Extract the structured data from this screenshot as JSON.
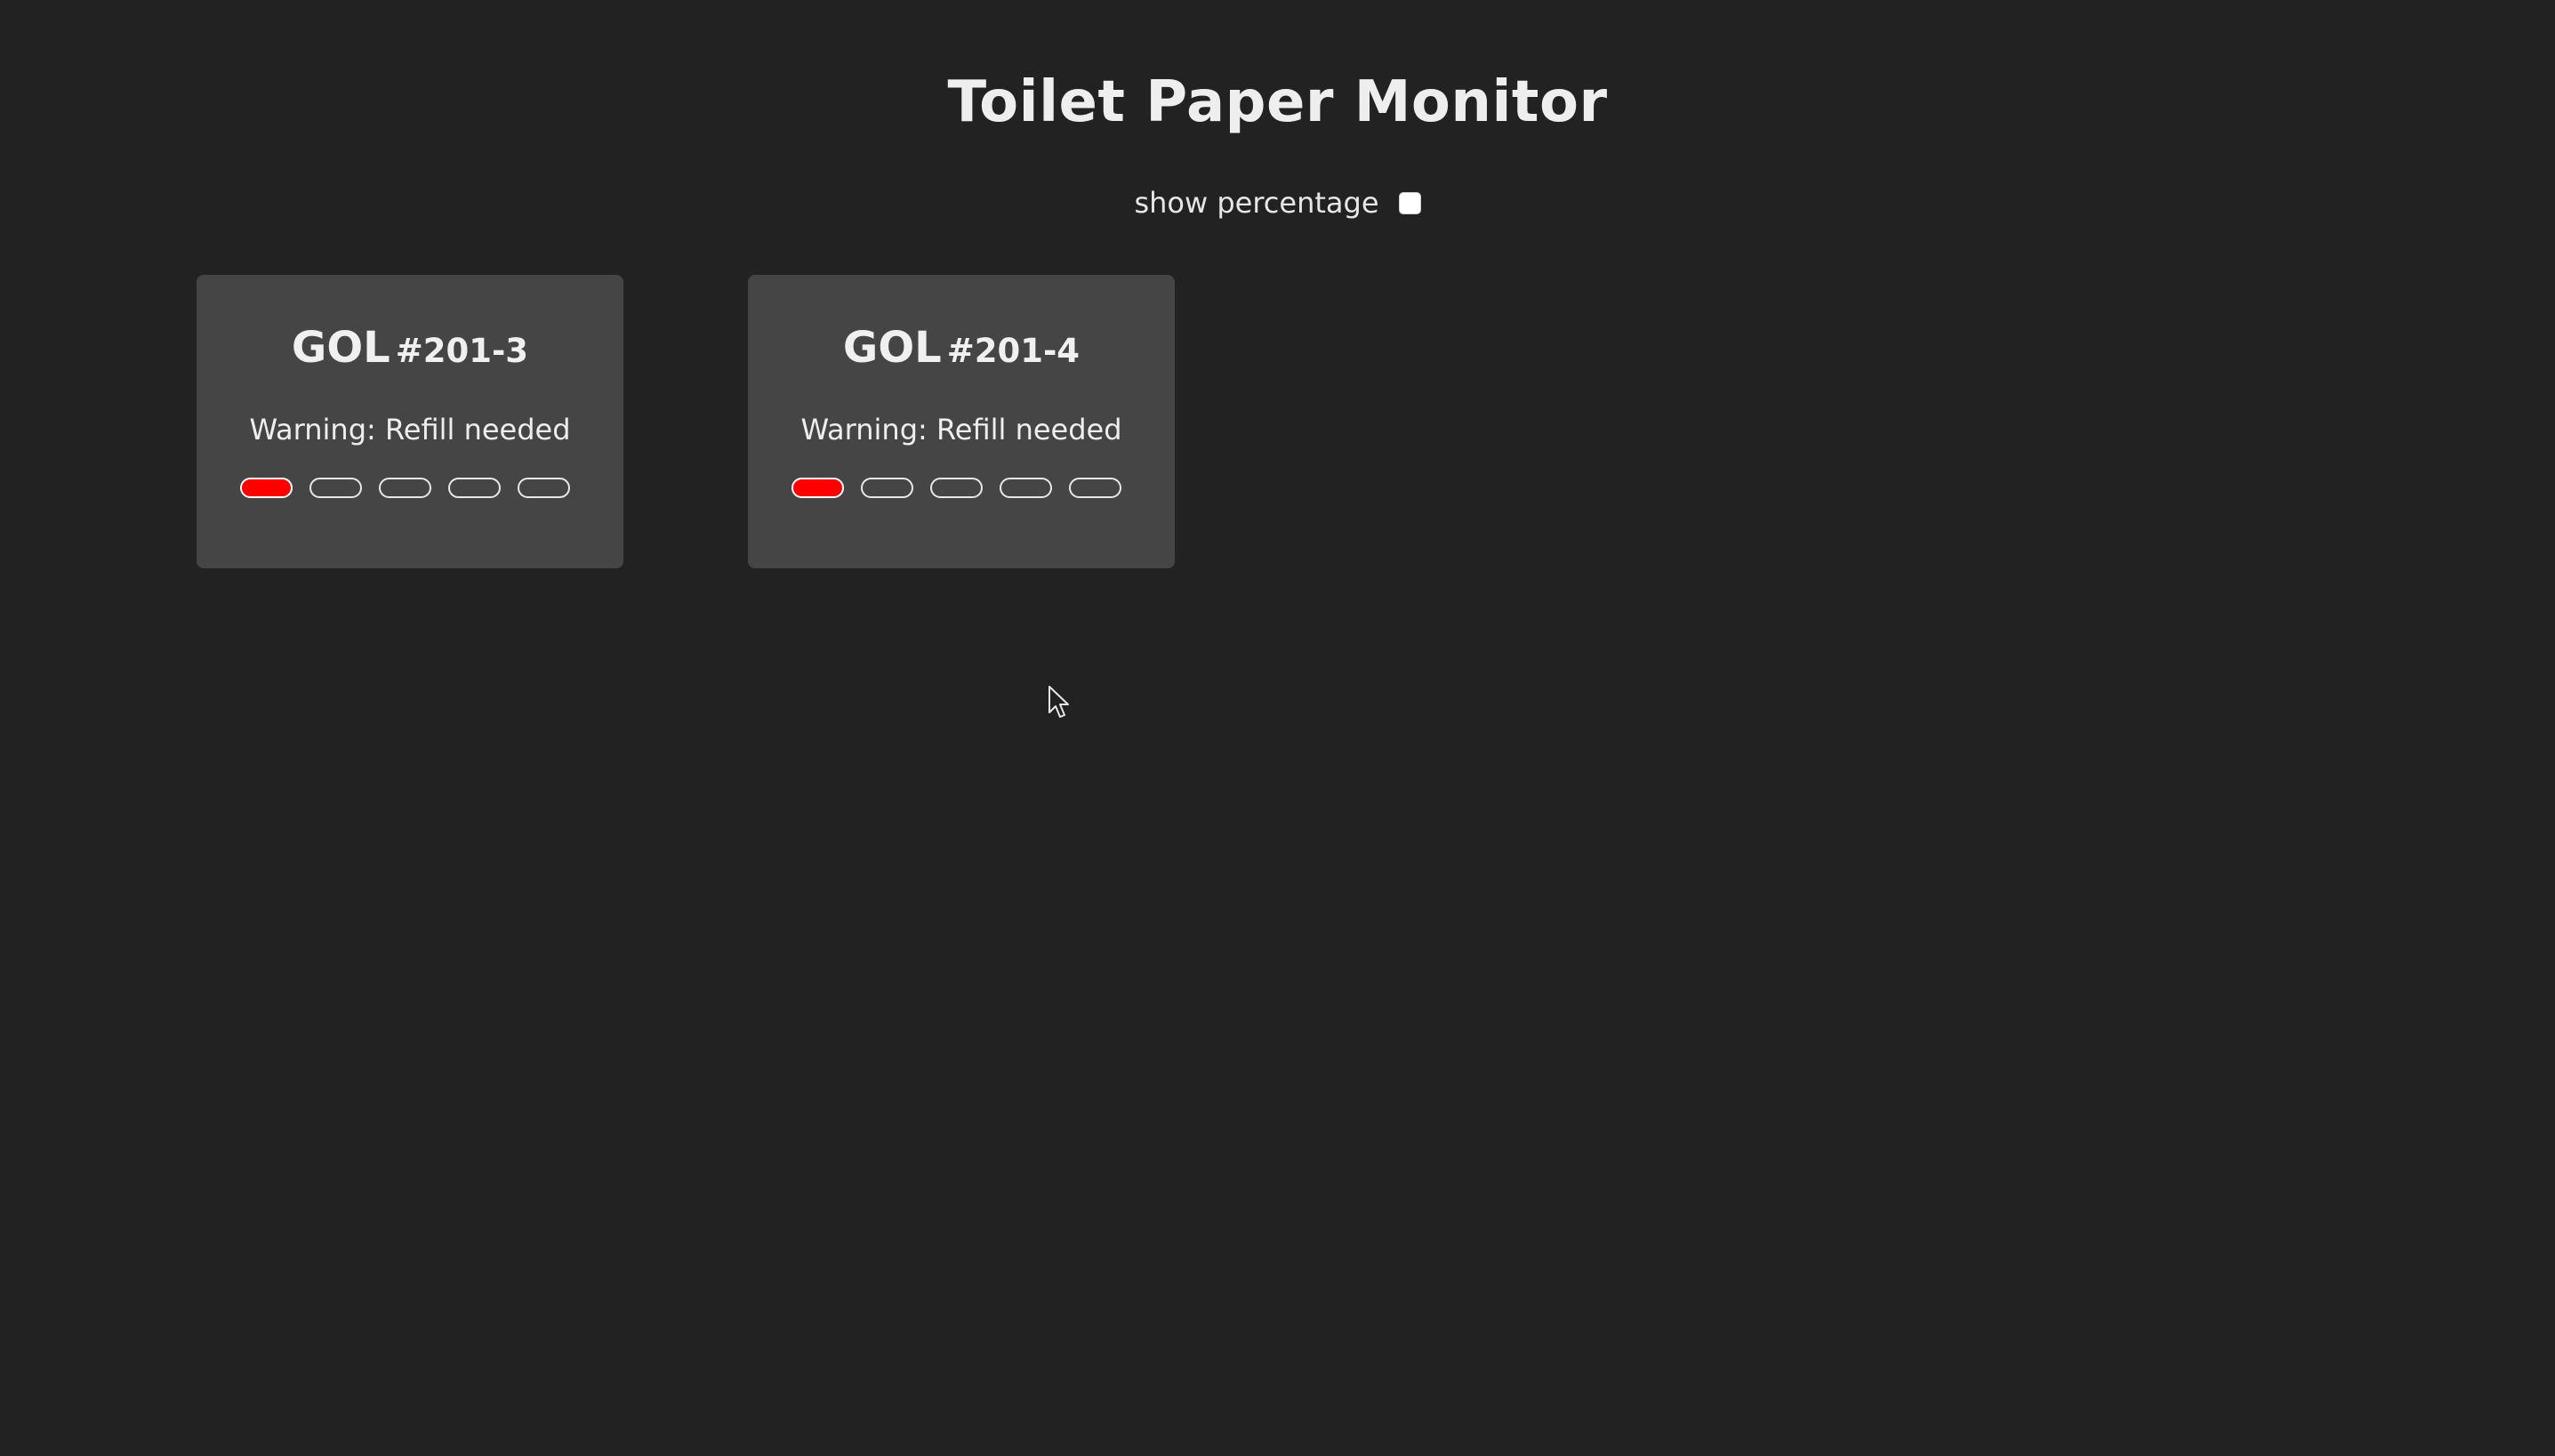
{
  "page": {
    "title": "Toilet Paper Monitor"
  },
  "controls": {
    "show_percentage_label": "show percentage",
    "show_percentage_checked": false
  },
  "colors": {
    "background": "#222222",
    "card": "#454545",
    "level_filled": "#ff0000",
    "level_empty_border": "#e8e8e8"
  },
  "dispensers": [
    {
      "prefix": "GOL",
      "number": "#201-3",
      "status": "Warning: Refill needed",
      "segments_total": 5,
      "segments_filled": 1
    },
    {
      "prefix": "GOL",
      "number": "#201-4",
      "status": "Warning: Refill needed",
      "segments_total": 5,
      "segments_filled": 1
    }
  ],
  "icons": {
    "cursor": "mouse-pointer-icon"
  }
}
